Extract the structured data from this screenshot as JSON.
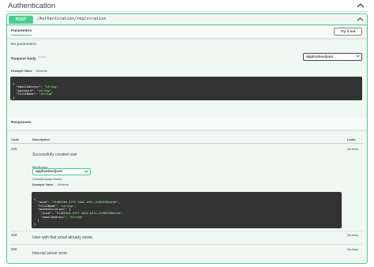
{
  "tag": {
    "title": "Authentication"
  },
  "operation": {
    "method": "POST",
    "path": "/Authentication/registration"
  },
  "parameters": {
    "title": "Parameters",
    "try_button": "Try it out",
    "empty_text": "No parameters",
    "request_body_label": "Request body",
    "required_marker": "required",
    "content_type": "application/json",
    "tab_example": "Example Value",
    "tab_schema": "Schema",
    "example_lines": [
      "{",
      "  \"emailAddress\": \"string\",",
      "  \"password\": \"string\",",
      "  \"firstName\": \"string\"",
      "}"
    ]
  },
  "responses": {
    "title": "Responses",
    "columns": {
      "code": "Code",
      "description": "Description",
      "links": "Links"
    },
    "rows": [
      {
        "code": "200",
        "description": "Successfully created user",
        "links": "No links",
        "media_type_label": "Media type",
        "media_type": "application/json",
        "controls_text": "Controls Accept header.",
        "tab_example": "Example Value",
        "tab_schema": "Schema",
        "example_lines": [
          "{",
          "  \"uuid\": \"3fa85f64-5717-4562-b3fc-2c963f66afa6\",",
          "  \"firstName\": \"string\",",
          "  \"authentication\": {",
          "    \"uuid\": \"3fa85f64-5717-4562-b3fc-2c963f66afa6\",",
          "    \"emailAddress\": \"string\"",
          "  }",
          "}"
        ]
      },
      {
        "code": "400",
        "description": "User with that email already exists.",
        "links": "No links"
      },
      {
        "code": "500",
        "description": "Internal server error",
        "links": "No links"
      }
    ]
  },
  "colors": {
    "post_accent": "#49cc90",
    "block_bg": "#eff8f3",
    "code_bg": "#333333"
  },
  "icons": {
    "collapse": "chevron-up-icon",
    "select_arrow": "chevron-down-icon"
  }
}
